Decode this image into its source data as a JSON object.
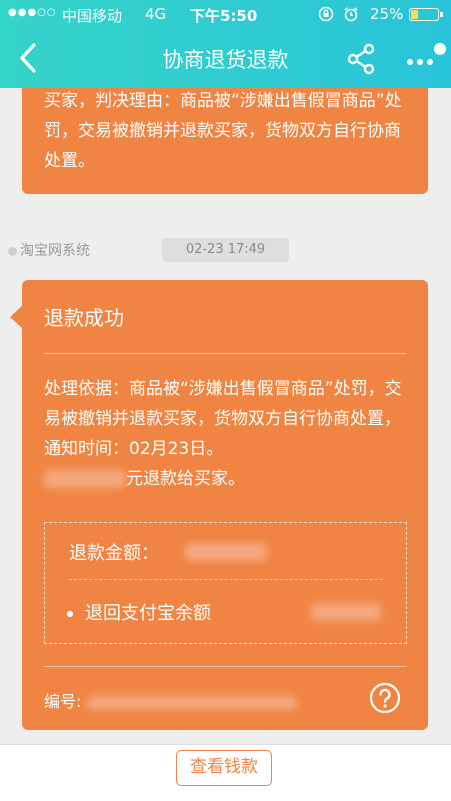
{
  "status_bar": {
    "signal": "●●●○○",
    "carrier": "中国移动",
    "network": "4G",
    "time": "下午5:50",
    "battery_percent": "25%",
    "battery_level": 0.25
  },
  "nav": {
    "title": "协商退货退款"
  },
  "previous_message": {
    "text": "买家，判决理由：商品被“涉嫌出售假冒商品”处罚，交易被撤销并退款买家，货物双方自行协商处置。"
  },
  "message": {
    "sender": "淘宝网系统",
    "timestamp": "02-23 17:49",
    "title": "退款成功",
    "body": "处理依据：商品被“涉嫌出售假冒商品”处罚，交易被撤销并退款买家，货物双方自行协商处置，通知时间：02月23日。",
    "refund_suffix": "元退款给买家。",
    "refund_amount_label": "退款金额：",
    "refund_destination": "退回支付宝余额",
    "serial_label": "编号:"
  },
  "bottom": {
    "view_money_button": "查看钱款"
  },
  "colors": {
    "accent": "#f08543",
    "header": "#2ac9d3"
  }
}
